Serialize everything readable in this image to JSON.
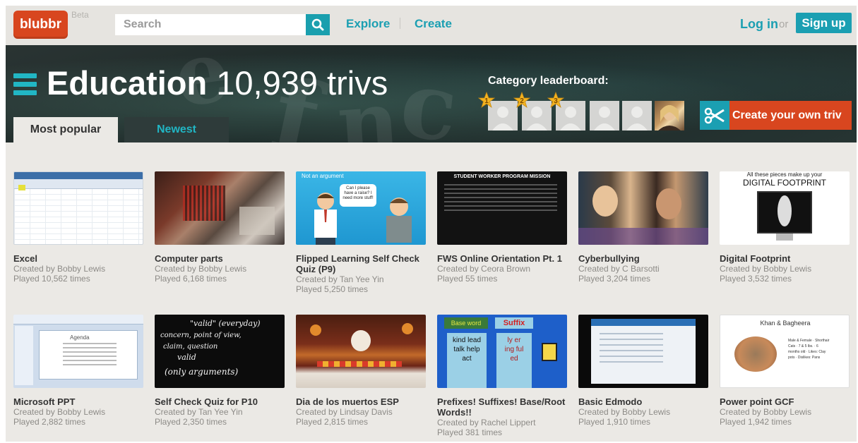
{
  "header": {
    "logo": "blubbr",
    "beta": "Beta",
    "search_placeholder": "Search",
    "explore": "Explore",
    "create": "Create",
    "login": "Log in",
    "or": "or",
    "signup": "Sign up"
  },
  "hero": {
    "category": "Education",
    "count": "10,939 trivs",
    "leaderboard_label": "Category leaderboard:",
    "ranks": [
      "1",
      "2",
      "3"
    ],
    "create_button": "Create your own triv",
    "tabs": [
      {
        "label": "Most popular",
        "active": true
      },
      {
        "label": "Newest",
        "active": false
      }
    ]
  },
  "cards": [
    {
      "title": "Excel",
      "creator": "Created by Bobby Lewis",
      "played": "Played 10,562 times",
      "thumb": "spreadsheet"
    },
    {
      "title": "Computer parts",
      "creator": "Created by Bobby Lewis",
      "played": "Played 6,168 times",
      "thumb": "motherboard"
    },
    {
      "title": "Flipped Learning Self Check Quiz (P9)",
      "creator": "Created by Tan Yee Yin",
      "played": "Played 5,250 times",
      "thumb": "cartoon",
      "caption_a": "Not an argument",
      "caption_b": "Can I please have a raise? I need more stuff!"
    },
    {
      "title": "FWS Online Orientation Pt. 1",
      "creator": "Created by Ceora Brown",
      "played": "Played 55 times",
      "thumb": "slide",
      "caption_a": "STUDENT WORKER PROGRAM MISSION"
    },
    {
      "title": "Cyberbullying",
      "creator": "Created by C Barsotti",
      "played": "Played 3,204 times",
      "thumb": "photo"
    },
    {
      "title": "Digital Footprint",
      "creator": "Created by Bobby Lewis",
      "played": "Played 3,532 times",
      "thumb": "footprint",
      "caption_a": "All these pieces make up your",
      "caption_b": "DIGITAL FOOTPRINT"
    },
    {
      "title": "Microsoft PPT",
      "creator": "Created by Bobby Lewis",
      "played": "Played 2,882 times",
      "thumb": "ppt",
      "caption_a": "Agenda"
    },
    {
      "title": "Self Check Quiz for P10",
      "creator": "Created by Tan Yee Yin",
      "played": "Played 2,350 times",
      "thumb": "chalkboard",
      "caption_a": "\"valid\" (everyday)",
      "caption_b": "concern, point of view,",
      "caption_c": "claim, question",
      "caption_d": "valid",
      "caption_e": "(only arguments)"
    },
    {
      "title": "Dia de los muertos ESP",
      "creator": "Created by Lindsay Davis",
      "played": "Played 2,815 times",
      "thumb": "altar"
    },
    {
      "title": "Prefixes! Suffixes! Base/Root Words!!",
      "creator": "Created by Rachel Lippert",
      "played": "Played 381 times",
      "thumb": "suffix",
      "caption_a": "Base word",
      "caption_b": "Suffix",
      "caption_c": "kind lead talk help act",
      "caption_d": "ly er ing ful ed"
    },
    {
      "title": "Basic Edmodo",
      "creator": "Created by Bobby Lewis",
      "played": "Played 1,910 times",
      "thumb": "edmodo"
    },
    {
      "title": "Power point GCF",
      "creator": "Created by Bobby Lewis",
      "played": "Played 1,942 times",
      "thumb": "khan",
      "caption_a": "Khan & Bagheera",
      "caption_b": "Male & Female · Shorthair Cats · 7 & 5 lbs. · 6 months old · Likes: Clay pots · Dislikes: Pans"
    }
  ]
}
